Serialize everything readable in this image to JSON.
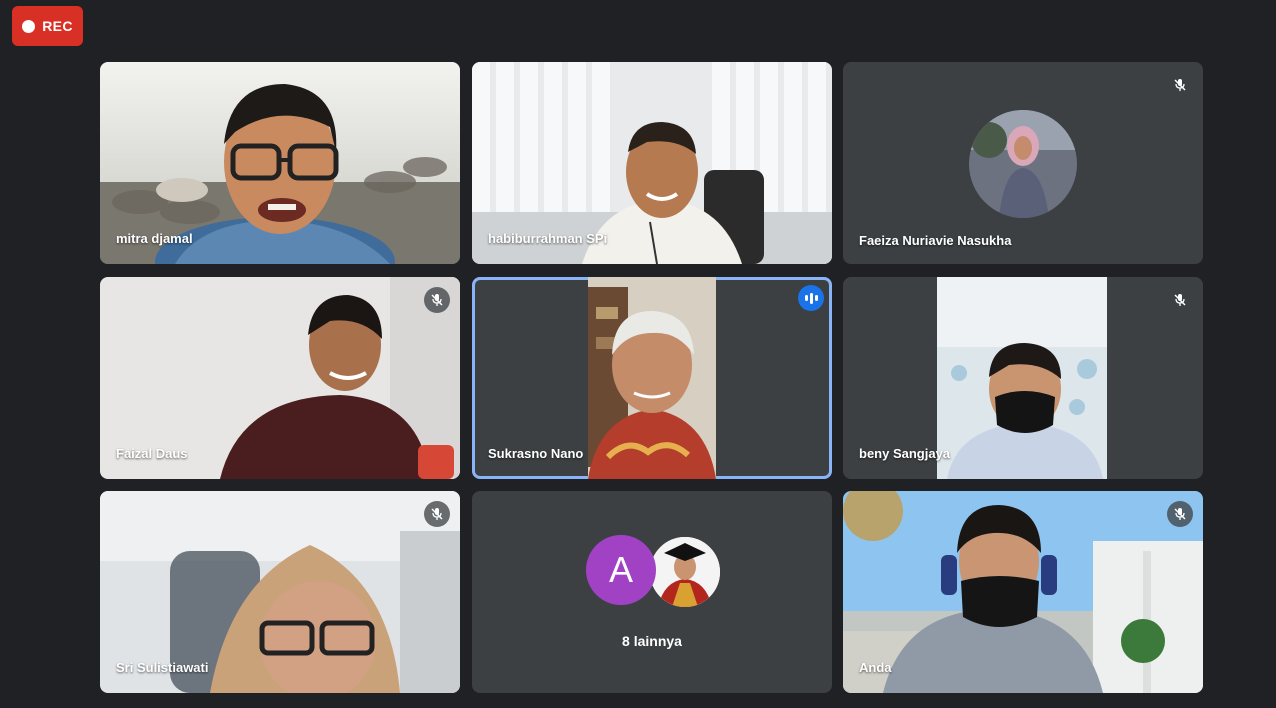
{
  "recording": {
    "label": "REC"
  },
  "participants": [
    {
      "name": "mitra djamal",
      "muted": false
    },
    {
      "name": "habiburrahman SPi",
      "muted": false
    },
    {
      "name": "Faeiza Nuriavie Nasukha",
      "muted": true
    },
    {
      "name": "Faizal Daus",
      "muted": true
    },
    {
      "name": "Sukrasno Nano",
      "muted": false,
      "speaking": true
    },
    {
      "name": "beny Sangjaya",
      "muted": true
    },
    {
      "name": "Sri Sulistiawati",
      "muted": true
    },
    {
      "name": "Anda",
      "muted": true
    }
  ],
  "others": {
    "avatar_letter": "A",
    "label": "8 lainnya"
  },
  "colors": {
    "background": "#202124",
    "tile": "#3c4043",
    "rec": "#d93025",
    "speaking_border": "#8ab4f8",
    "avatar_purple": "#a142c5"
  },
  "icons": {
    "muted": "mic-off-icon",
    "speaking": "audio-level-icon",
    "record": "record-dot-icon"
  }
}
